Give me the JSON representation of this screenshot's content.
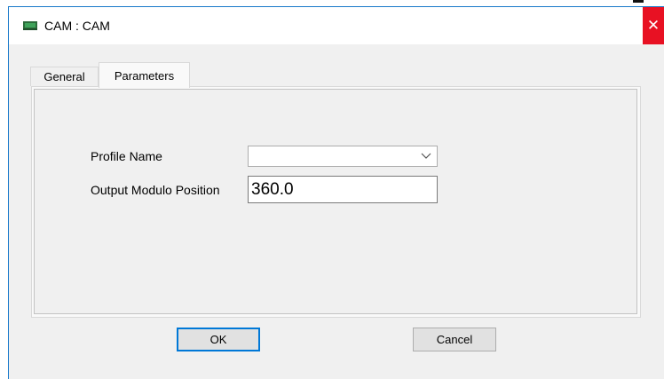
{
  "window": {
    "title": "CAM : CAM",
    "close_glyph": "✕",
    "icon": "app-icon"
  },
  "tabs": [
    {
      "label": "General",
      "active": false
    },
    {
      "label": "Parameters",
      "active": true
    }
  ],
  "form": {
    "profile_name_label": "Profile Name",
    "profile_name_value": "",
    "output_modulo_label": "Output Modulo Position",
    "output_modulo_value": "360.0"
  },
  "buttons": {
    "ok_label": "OK",
    "cancel_label": "Cancel"
  },
  "colors": {
    "accent": "#0078d7",
    "close": "#e81123",
    "dialog_bg": "#f0f0f0"
  }
}
